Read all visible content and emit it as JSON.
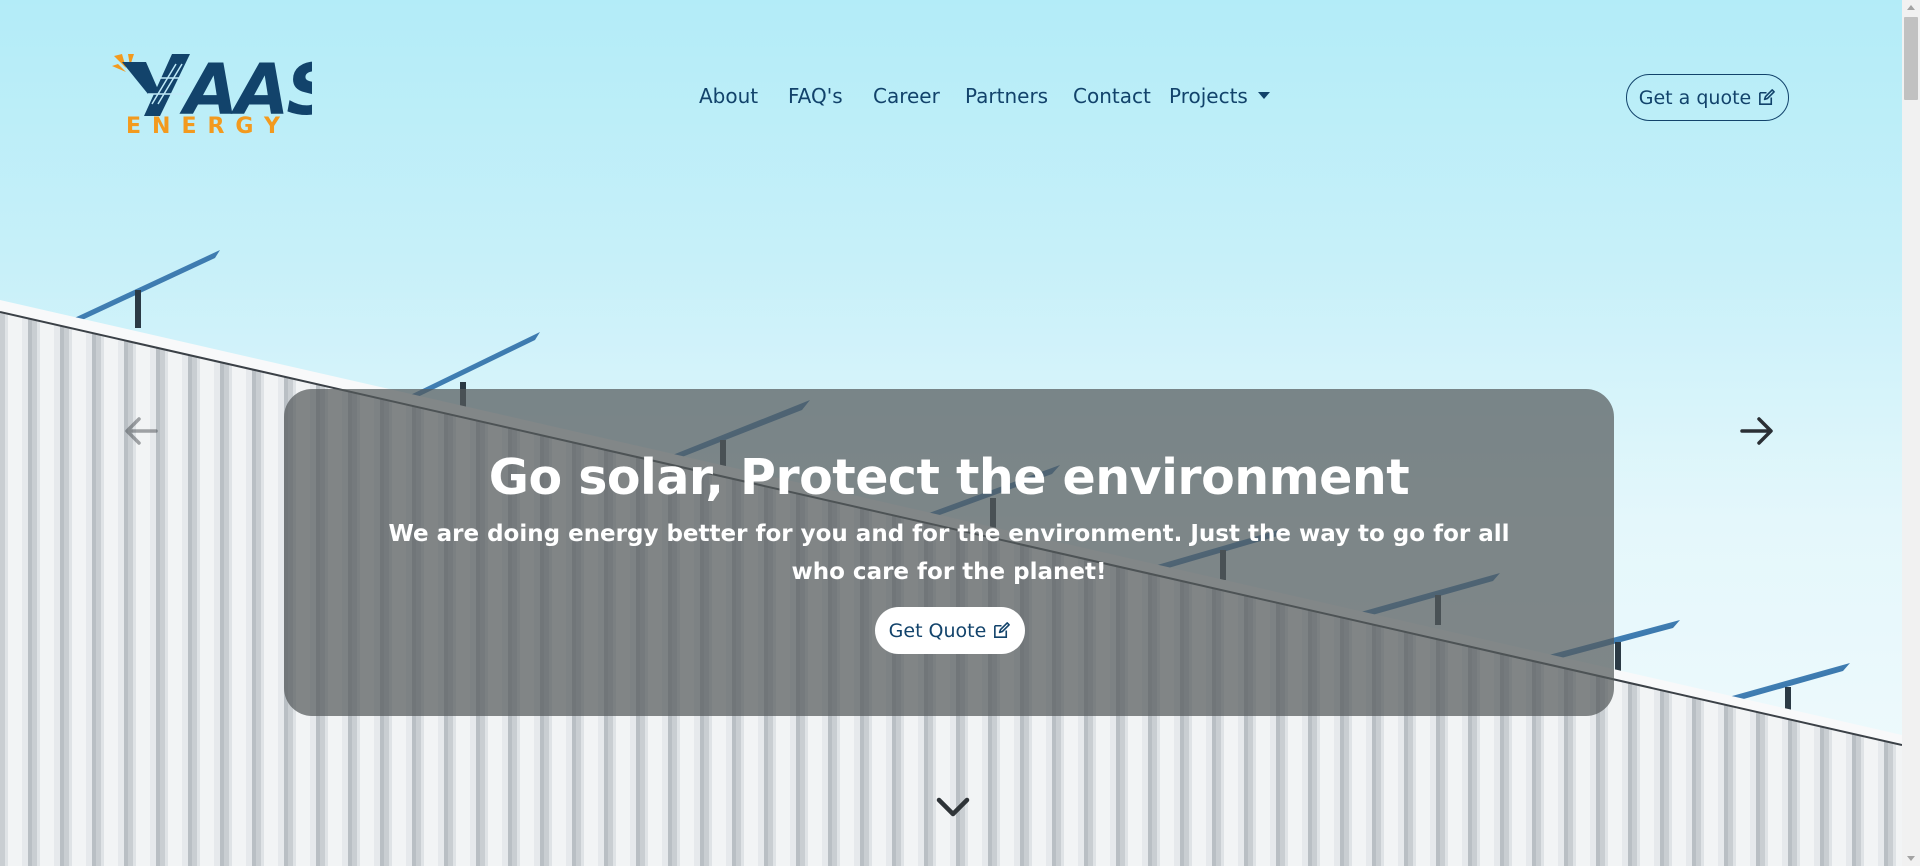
{
  "brand": {
    "name": "AAS",
    "tagline": "ENERGY",
    "colors": {
      "navy": "#12436b",
      "orange": "#f39a1e"
    }
  },
  "nav": {
    "items": [
      {
        "label": "About"
      },
      {
        "label": "FAQ's"
      },
      {
        "label": "Career"
      },
      {
        "label": "Partners"
      },
      {
        "label": "Contact"
      },
      {
        "label": "Projects"
      }
    ],
    "cta_label": "Get a quote",
    "cta_icon": "edit-icon",
    "dropdown_icon": "caret-down-icon"
  },
  "hero": {
    "title": "Go solar, Protect the environment",
    "subtitle": "We are doing energy better for you and for the environment. Just the way to go for all who care for the planet!",
    "button_label": "Get Quote",
    "button_icon": "edit-icon",
    "prev_icon": "arrow-left-icon",
    "next_icon": "arrow-right-icon",
    "scroll_icon": "chevron-down-icon"
  }
}
